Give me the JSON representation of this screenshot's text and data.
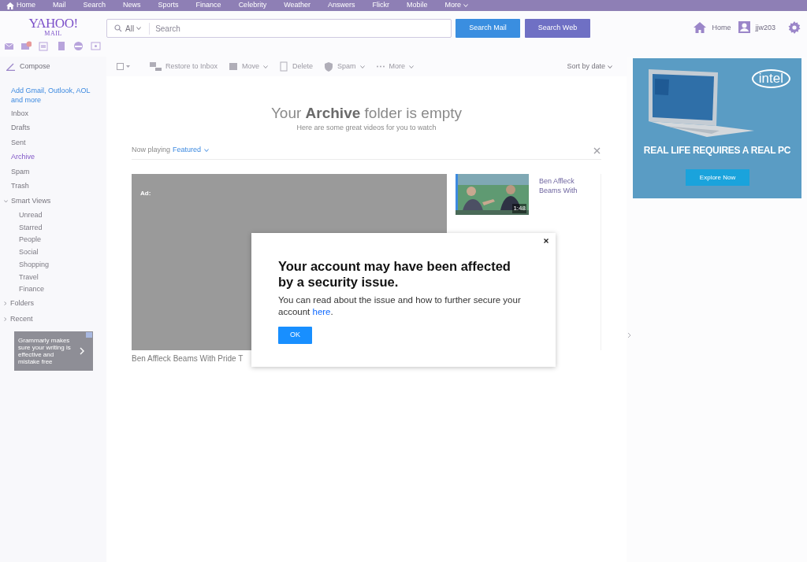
{
  "top_nav": {
    "items": [
      {
        "label": "Home",
        "kind": "home"
      },
      {
        "label": "Mail",
        "kind": "link"
      },
      {
        "label": "Search",
        "kind": "link"
      },
      {
        "label": "News",
        "kind": "link"
      },
      {
        "label": "Sports",
        "kind": "link"
      },
      {
        "label": "Finance",
        "kind": "link"
      },
      {
        "label": "Celebrity",
        "kind": "link"
      },
      {
        "label": "Weather",
        "kind": "link"
      },
      {
        "label": "Answers",
        "kind": "link"
      },
      {
        "label": "Flickr",
        "kind": "link"
      },
      {
        "label": "Mobile",
        "kind": "link"
      },
      {
        "label": "More",
        "kind": "dropdown"
      }
    ]
  },
  "header": {
    "logo": {
      "brand": "YAHOO!",
      "sub": "MAIL"
    },
    "search": {
      "scope": "All",
      "placeholder": "Search"
    },
    "buttons": [
      "Search Mail",
      "Search Web"
    ],
    "home": "Home",
    "user": "jjw203"
  },
  "sidebar": {
    "compose": "Compose",
    "add_accounts": "Add Gmail, Outlook, AOL and more",
    "folders": [
      {
        "label": "Inbox",
        "selected": false
      },
      {
        "label": "Drafts",
        "selected": false
      },
      {
        "label": "Sent",
        "selected": false
      },
      {
        "label": "Archive",
        "selected": true
      },
      {
        "label": "Spam",
        "selected": false
      },
      {
        "label": "Trash",
        "selected": false
      }
    ],
    "sections": [
      {
        "label": "Smart Views",
        "expanded": true,
        "children": [
          {
            "label": "Unread"
          },
          {
            "label": "Starred"
          },
          {
            "label": "People"
          },
          {
            "label": "Social"
          },
          {
            "label": "Shopping"
          },
          {
            "label": "Travel"
          },
          {
            "label": "Finance"
          }
        ]
      },
      {
        "label": "Folders",
        "expanded": false
      },
      {
        "label": "Recent",
        "expanded": false
      }
    ],
    "ad": {
      "text": "Grammarly makes sure your writing is effective and mistake free"
    }
  },
  "toolbar": {
    "select_all": {
      "checked": false
    },
    "actions": [
      {
        "label": "Restore to Inbox",
        "kind": "button"
      },
      {
        "label": "Move",
        "kind": "dropdown"
      },
      {
        "label": "Delete",
        "kind": "button"
      },
      {
        "label": "Spam",
        "kind": "dropdown"
      },
      {
        "label": "More",
        "kind": "dropdown"
      }
    ],
    "sort": "Sort by date"
  },
  "empty_state": {
    "title": "Your **Archive** folder is empty",
    "subtitle": "Here are some great videos for you to watch"
  },
  "videos": {
    "now_playing": "Now playing",
    "channel": "Featured",
    "player": {
      "ad_label": "Ad:",
      "caption": "Ben Affleck Beams With Pride T"
    },
    "playlist": [
      {
        "title": "Ben Affleck Beams With",
        "duration": "1:48"
      }
    ]
  },
  "ad": {
    "logo": "intel",
    "headline": "REAL LIFE REQUIRES A REAL PC",
    "button": "Explore Now"
  },
  "modal": {
    "title": "Your account may have been affected by a security issue.",
    "body": "You can read about the issue and how to further secure your account ",
    "link": "here",
    "tail": ".",
    "button": "OK"
  }
}
